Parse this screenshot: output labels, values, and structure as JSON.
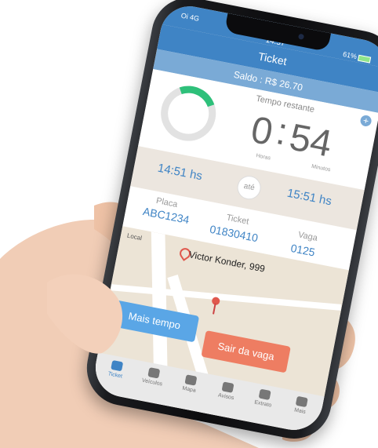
{
  "status": {
    "carrier": "Oi  4G",
    "clock": "14:57",
    "battery": "61%"
  },
  "header": {
    "title": "Ticket"
  },
  "saldo": "Saldo : R$ 26.70",
  "timer": {
    "label": "Tempo restante",
    "hours": "0",
    "minutes": "54",
    "hours_label": "Horas",
    "minutes_label": "Minutos",
    "ring_color": "#2ec07a"
  },
  "range": {
    "start": "14:51 hs",
    "separator": "até",
    "end": "15:51 hs"
  },
  "ticket": {
    "placa_label": "Placa",
    "placa": "ABC1234",
    "ticket_label": "Ticket",
    "ticket": "01830410",
    "vaga_label": "Vaga",
    "vaga": "0125"
  },
  "map": {
    "local_label": "Local",
    "address": "Victor Konder, 999"
  },
  "actions": {
    "more_time": "Mais tempo",
    "leave": "Sair da vaga"
  },
  "tabs": [
    {
      "label": "Ticket",
      "icon": "ticket-icon"
    },
    {
      "label": "Veículos",
      "icon": "car-icon"
    },
    {
      "label": "Mapa",
      "icon": "globe-icon"
    },
    {
      "label": "Avisos",
      "icon": "document-icon"
    },
    {
      "label": "Extrato",
      "icon": "checkbox-icon"
    },
    {
      "label": "Mais",
      "icon": "menu-icon"
    }
  ],
  "colors": {
    "primary": "#3f84c5",
    "accent": "#ee7d62",
    "button_blue": "#5aa6e6"
  }
}
